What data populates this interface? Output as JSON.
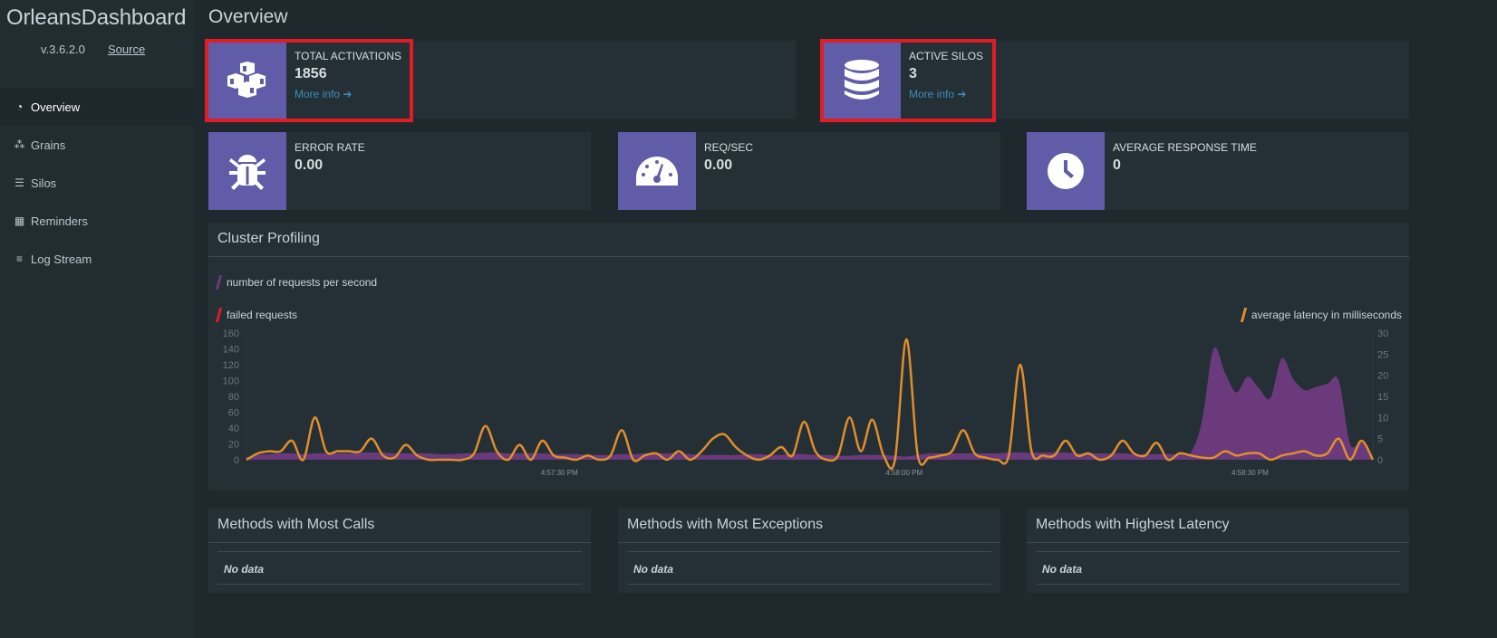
{
  "sidebar": {
    "brand": "OrleansDashboard",
    "version": "v.3.6.2.0",
    "source_link": "Source",
    "items": [
      {
        "label": "Overview",
        "icon": "dashboard-icon"
      },
      {
        "label": "Grains",
        "icon": "cubes-icon"
      },
      {
        "label": "Silos",
        "icon": "database-icon"
      },
      {
        "label": "Reminders",
        "icon": "calendar-icon"
      },
      {
        "label": "Log Stream",
        "icon": "bars-icon"
      }
    ]
  },
  "page": {
    "title": "Overview"
  },
  "stats": {
    "total_activations": {
      "label": "TOTAL ACTIVATIONS",
      "value": "1856",
      "more": "More info"
    },
    "active_silos": {
      "label": "ACTIVE SILOS",
      "value": "3",
      "more": "More info"
    },
    "error_rate": {
      "label": "ERROR RATE",
      "value": "0.00"
    },
    "req_sec": {
      "label": "REQ/SEC",
      "value": "0.00"
    },
    "avg_response": {
      "label": "AVERAGE RESPONSE TIME",
      "value": "0"
    }
  },
  "colors": {
    "accent": "#605ca8",
    "highlight": "#e31b23",
    "requests": "#6a3a7c",
    "failed": "#e31b23",
    "latency": "#e08e2b",
    "link": "#3c8dbc"
  },
  "cluster": {
    "title": "Cluster Profiling"
  },
  "chart_data": {
    "type": "area",
    "legend": {
      "requests": "number of requests per second",
      "failed": "failed requests",
      "latency": "average latency in milliseconds"
    },
    "left_ylim": [
      0,
      160
    ],
    "left_ticks": [
      "0",
      "20",
      "40",
      "60",
      "80",
      "100",
      "120",
      "140",
      "160"
    ],
    "right_ylim": [
      0,
      30
    ],
    "right_ticks": [
      "0",
      "5",
      "10",
      "15",
      "20",
      "25",
      "30"
    ],
    "x_ticks": [
      {
        "label": "4:57:30 PM",
        "index": 27.5
      },
      {
        "label": "4:58:00 PM",
        "index": 57.8
      },
      {
        "label": "4:58:30 PM",
        "index": 88.2
      }
    ],
    "requests": [
      3,
      6,
      7,
      8,
      8,
      7,
      8,
      8,
      8,
      8,
      9,
      9,
      9,
      8,
      8,
      8,
      8,
      7,
      7,
      8,
      8,
      9,
      9,
      8,
      8,
      8,
      8,
      7,
      7,
      7,
      6,
      6,
      6,
      7,
      7,
      8,
      8,
      8,
      8,
      7,
      6,
      6,
      6,
      6,
      7,
      7,
      6,
      6,
      7,
      7,
      6,
      6,
      5,
      5,
      6,
      6,
      6,
      5,
      4,
      6,
      8,
      8,
      8,
      8,
      8,
      8,
      8,
      9,
      9,
      9,
      9,
      9,
      9,
      8,
      8,
      8,
      8,
      8,
      7,
      7,
      7,
      7,
      7,
      9,
      50,
      140,
      110,
      85,
      105,
      90,
      78,
      128,
      102,
      88,
      92,
      96,
      100,
      20,
      22,
      0
    ],
    "latency": [
      0,
      1.5,
      2,
      2,
      4.5,
      0,
      10,
      2,
      2,
      2,
      2,
      5,
      1,
      0.5,
      3.5,
      1,
      0,
      0,
      0,
      0,
      1.5,
      8,
      2,
      0,
      3.5,
      0,
      4.5,
      1,
      0.5,
      0,
      1,
      0,
      1,
      7,
      0,
      1,
      1.5,
      0,
      2,
      0,
      2,
      5,
      6,
      3,
      1,
      0,
      1,
      3,
      1,
      9,
      2,
      0,
      1,
      10,
      2,
      9.5,
      1,
      0,
      28.5,
      1,
      0.5,
      1,
      2,
      7,
      1.5,
      0.5,
      0,
      1,
      22.5,
      2,
      1,
      1,
      4.5,
      1,
      1.5,
      0,
      1,
      4.5,
      1.5,
      1,
      4,
      0,
      1.5,
      1,
      0.5,
      0.5,
      2,
      1,
      1.5,
      1.5,
      0,
      1,
      1.5,
      2,
      1,
      1.5,
      5,
      0,
      4.5,
      0
    ],
    "failed": []
  },
  "tables": [
    {
      "title": "Methods with Most Calls",
      "empty": "No data"
    },
    {
      "title": "Methods with Most Exceptions",
      "empty": "No data"
    },
    {
      "title": "Methods with Highest Latency",
      "empty": "No data"
    }
  ]
}
